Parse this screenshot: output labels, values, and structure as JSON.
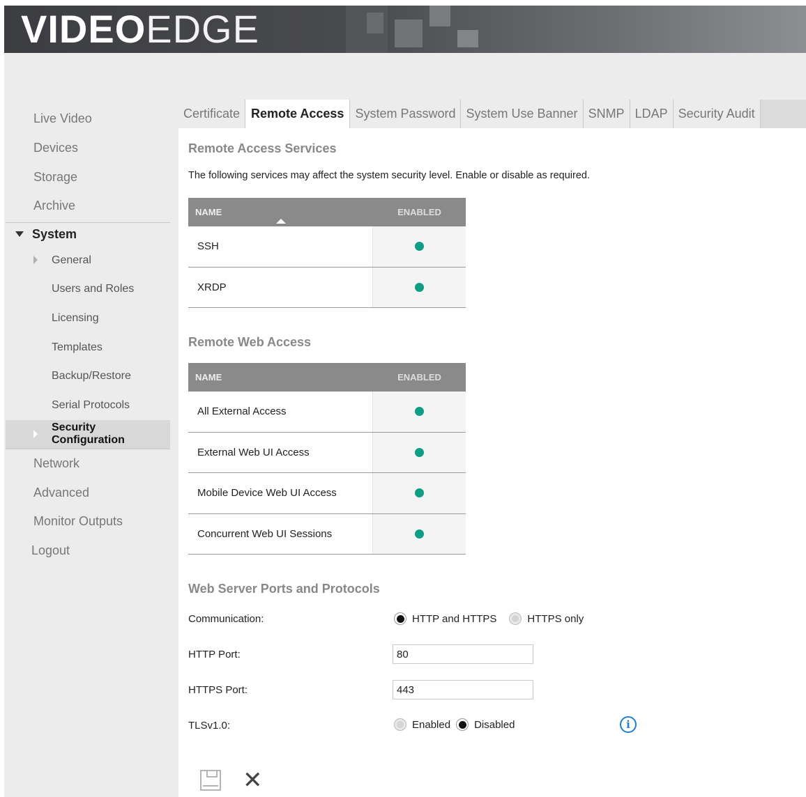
{
  "app": {
    "logo_bold": "VIDEO",
    "logo_thin": "EDGE"
  },
  "sidebar": {
    "top_items": [
      "Live Video",
      "Devices",
      "Storage",
      "Archive"
    ],
    "section": "System",
    "sub_items": [
      "General",
      "Users and Roles",
      "Licensing",
      "Templates",
      "Backup/Restore",
      "Serial Protocols",
      "Security Configuration"
    ],
    "bottom_items": [
      "Network",
      "Advanced",
      "Monitor Outputs",
      "Logout"
    ]
  },
  "tabs": [
    "Certificate",
    "Remote Access",
    "System Password",
    "System Use Banner",
    "SNMP",
    "LDAP",
    "Security Audit"
  ],
  "active_tab": "Remote Access",
  "remote_access": {
    "title": "Remote Access Services",
    "description": "The following services may affect the system security level. Enable or disable as required.",
    "headers": {
      "name": "NAME",
      "enabled": "ENABLED"
    },
    "rows": [
      {
        "name": "SSH",
        "enabled": true
      },
      {
        "name": "XRDP",
        "enabled": true
      }
    ]
  },
  "web_access": {
    "title": "Remote Web Access",
    "headers": {
      "name": "NAME",
      "enabled": "ENABLED"
    },
    "rows": [
      {
        "name": "All External Access",
        "enabled": true
      },
      {
        "name": "External Web UI Access",
        "enabled": true
      },
      {
        "name": "Mobile Device Web UI Access",
        "enabled": true
      },
      {
        "name": "Concurrent Web UI Sessions",
        "enabled": true
      }
    ]
  },
  "ports": {
    "title": "Web Server Ports and Protocols",
    "communication_label": "Communication:",
    "communication_options": [
      "HTTP and HTTPS",
      "HTTPS only"
    ],
    "communication_selected": "HTTP and HTTPS",
    "http_label": "HTTP Port:",
    "http_value": "80",
    "https_label": "HTTPS Port:",
    "https_value": "443",
    "tls_label": "TLSv1.0:",
    "tls_options": [
      "Enabled",
      "Disabled"
    ],
    "tls_selected": "Disabled"
  },
  "colors": {
    "enabled_dot": "#0e9e84",
    "info": "#1e7fd0",
    "header_bg": "#8a8a8a"
  },
  "icons": {
    "save": "save-icon",
    "cancel": "cancel-icon",
    "info": "info-icon"
  }
}
